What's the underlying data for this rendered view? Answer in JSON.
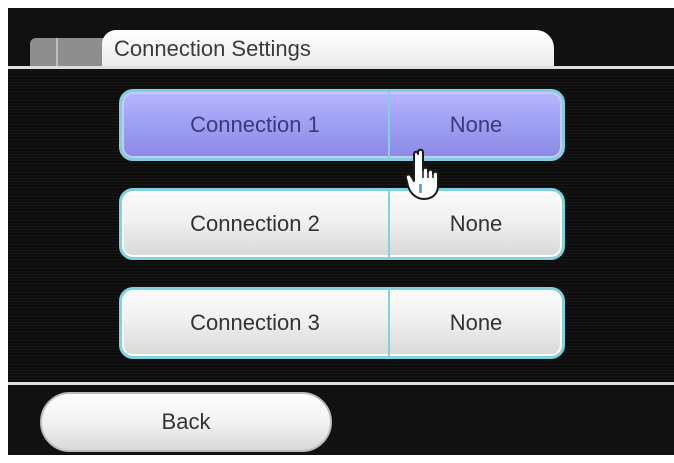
{
  "header": {
    "title": "Connection Settings"
  },
  "connections": [
    {
      "name": "Connection 1",
      "value": "None",
      "selected": true
    },
    {
      "name": "Connection 2",
      "value": "None",
      "selected": false
    },
    {
      "name": "Connection 3",
      "value": "None",
      "selected": false
    }
  ],
  "footer": {
    "back_label": "Back"
  },
  "colors": {
    "selected_fill": "#a0a0f4",
    "button_border": "#7fd2df",
    "background": "#0d0d0d"
  },
  "icons": {
    "cursor": "pointing-hand-icon"
  }
}
